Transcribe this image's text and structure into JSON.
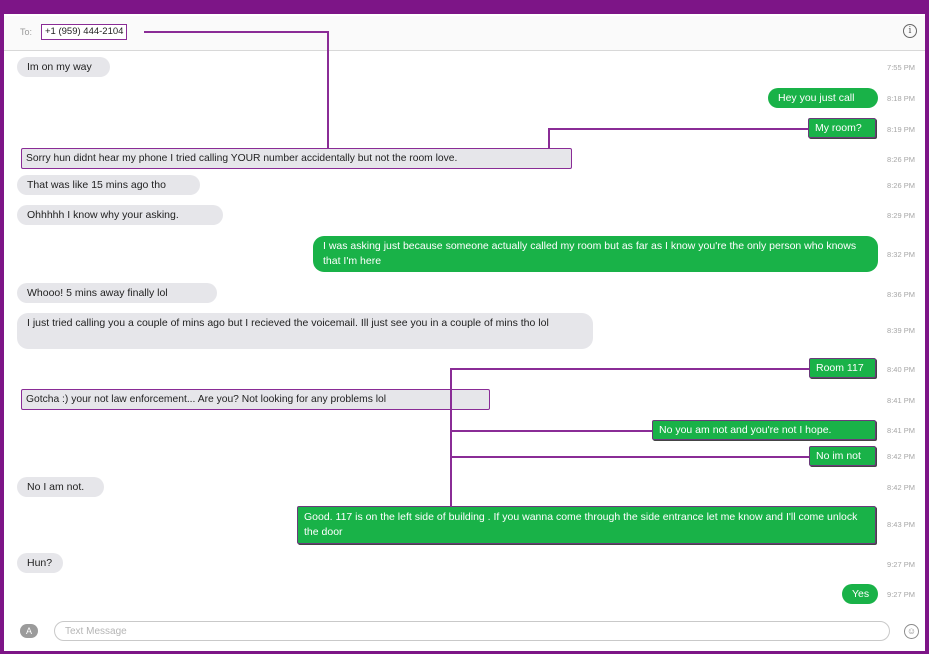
{
  "header": {
    "to_label": "To:",
    "recipient": "+1 (959) 444-2104",
    "info_glyph": "i"
  },
  "messages": [
    {
      "side": "in",
      "text": "Im on my way",
      "time": "7:55 PM"
    },
    {
      "side": "out",
      "text": "Hey you just call",
      "time": "8:18 PM"
    },
    {
      "side": "out",
      "text": "My room?",
      "time": "8:19 PM"
    },
    {
      "side": "in",
      "text": "Sorry hun didnt hear my phone I tried calling YOUR number accidentally but not the room love.",
      "time": "8:26 PM"
    },
    {
      "side": "in",
      "text": "That was like 15 mins ago tho",
      "time": "8:26 PM"
    },
    {
      "side": "in",
      "text": "Ohhhhh I know why your asking.",
      "time": "8:29 PM"
    },
    {
      "side": "out",
      "text": "I was asking just because someone actually called my room but as far as I know you're the only person who knows that I'm here",
      "time": "8:32 PM"
    },
    {
      "side": "in",
      "text": "Whooo! 5 mins away finally lol",
      "time": "8:36 PM"
    },
    {
      "side": "in",
      "text": "I just tried calling you a couple of mins ago but I recieved the voicemail. Ill just see you in a couple of mins tho lol",
      "time": "8:39 PM"
    },
    {
      "side": "out",
      "text": "Room 117",
      "time": "8:40 PM"
    },
    {
      "side": "in",
      "text": "Gotcha :) your not law enforcement... Are you? Not looking for any problems lol",
      "time": "8:41 PM"
    },
    {
      "side": "out",
      "text": "No you am not and you're not I hope.",
      "time": "8:41 PM"
    },
    {
      "side": "out",
      "text": "No im not",
      "time": "8:42 PM"
    },
    {
      "side": "in",
      "text": "No I am not.",
      "time": "8:42 PM"
    },
    {
      "side": "out",
      "text": "Good. 117 is on the left side of building . If you wanna come through the side entrance let me know and I'll come unlock the door",
      "time": "8:43 PM"
    },
    {
      "side": "in",
      "text": "Hun?",
      "time": "9:27 PM"
    },
    {
      "side": "out",
      "text": "Yes",
      "time": "9:27 PM"
    }
  ],
  "composer": {
    "placeholder": "Text Message",
    "apps_icon": "apps-icon",
    "emoji_icon": "emoji-icon"
  },
  "colors": {
    "frame": "#7d1587",
    "annotation": "#8a2c96",
    "outgoing_bubble": "#19b248",
    "incoming_bubble": "#e6e6ea"
  }
}
